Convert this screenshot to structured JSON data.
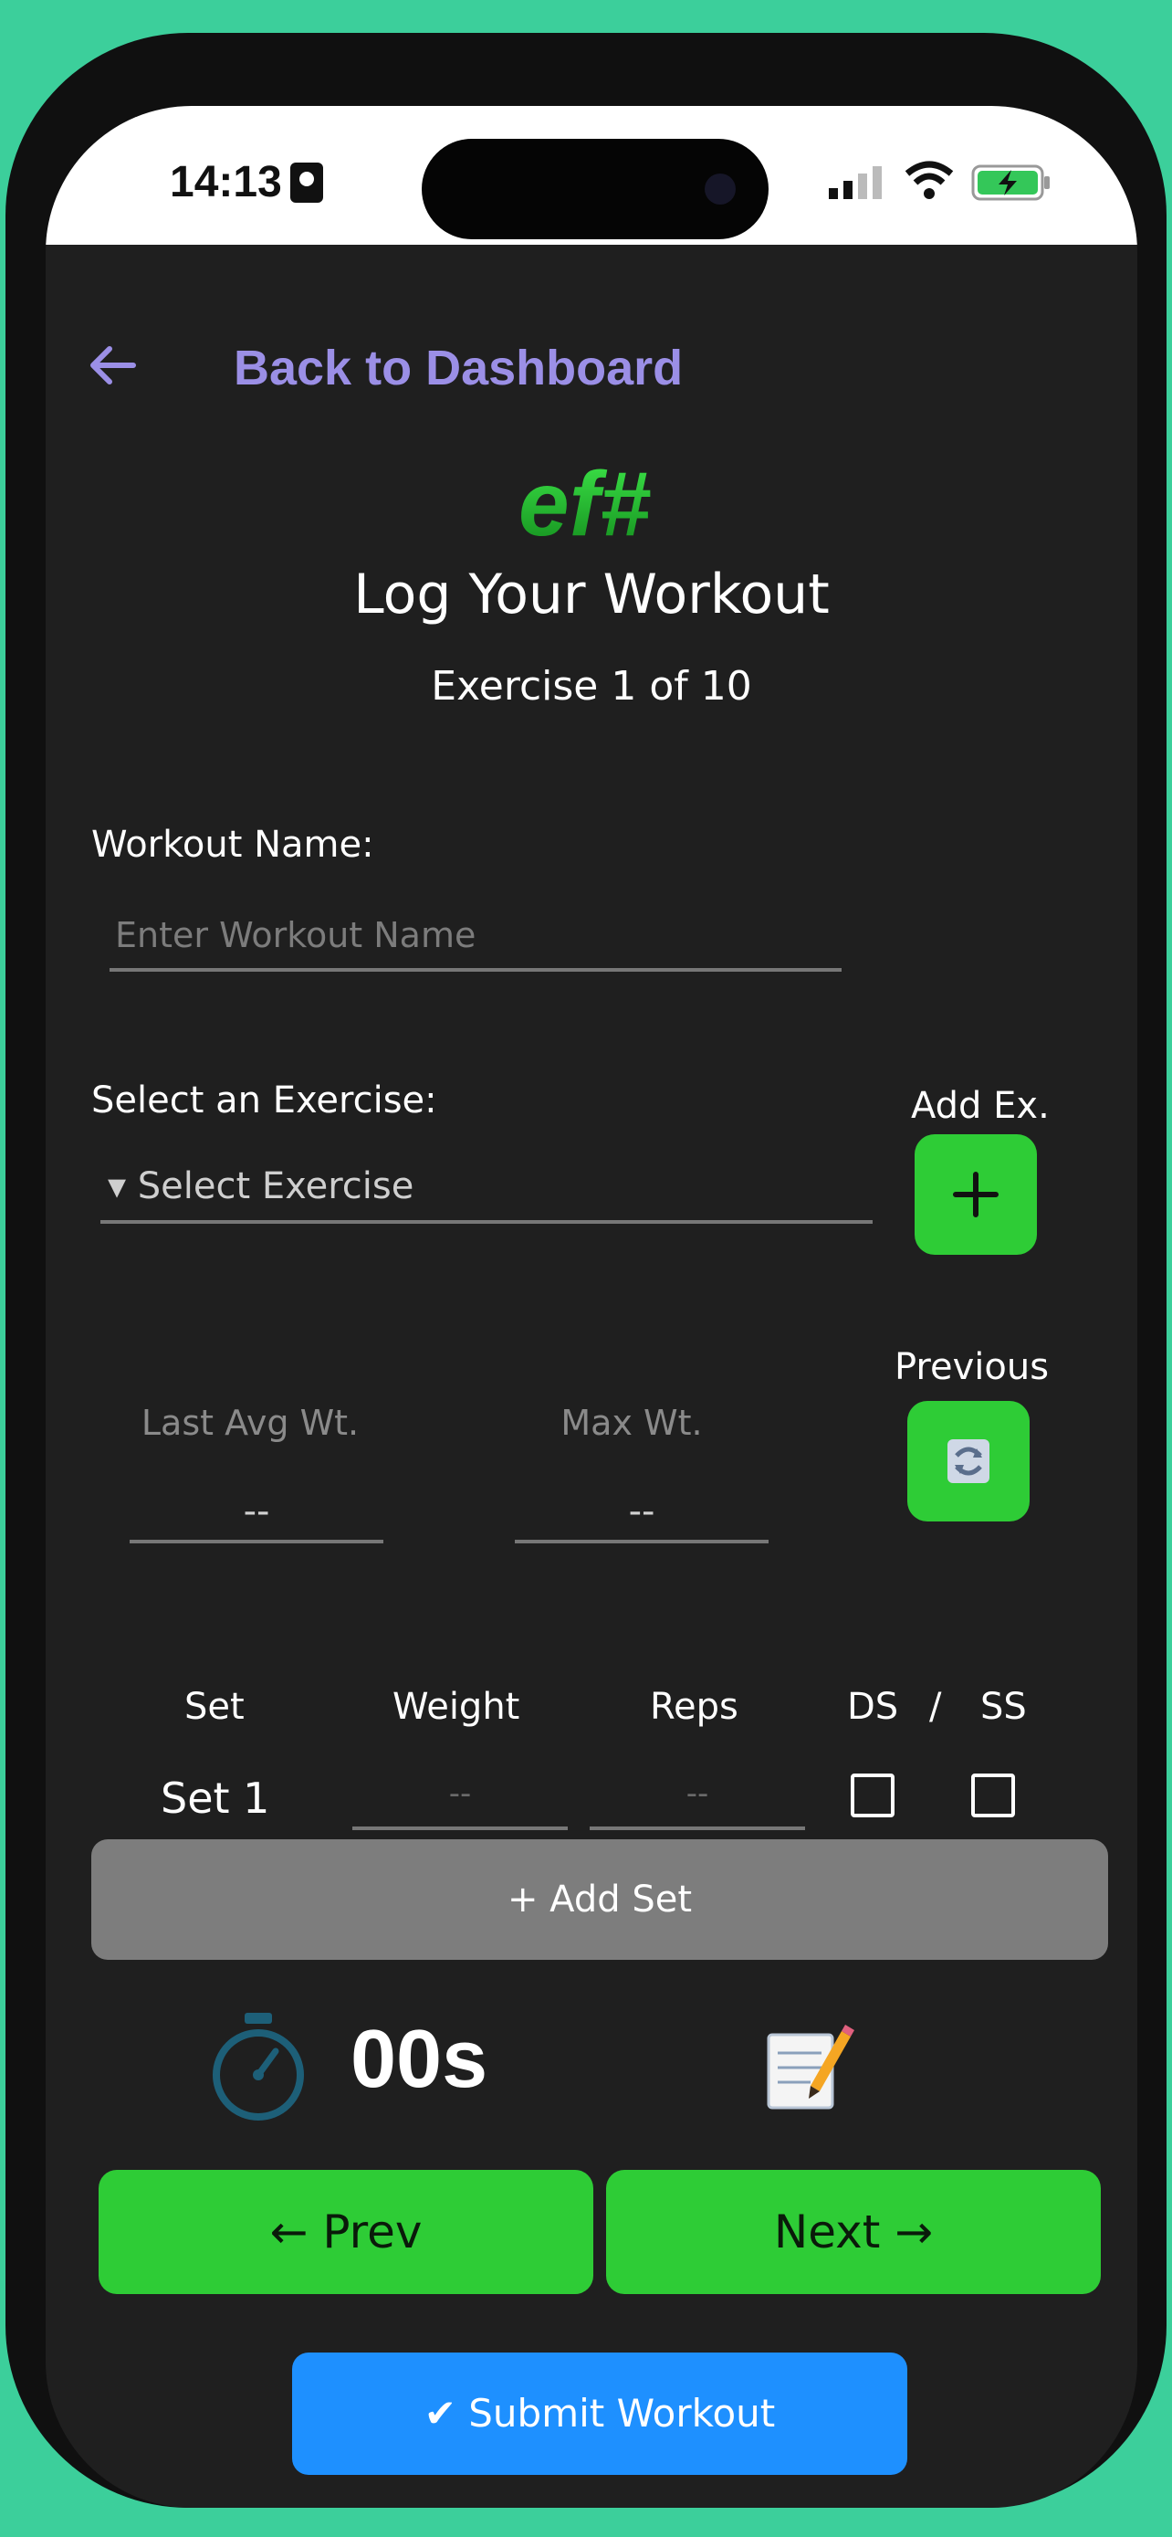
{
  "status_bar": {
    "time": "14:13"
  },
  "header": {
    "back_label": "Back to Dashboard"
  },
  "logo": {
    "text": "ef#"
  },
  "page": {
    "title": "Log Your Workout",
    "subtitle": "Exercise 1 of 10"
  },
  "workout_name": {
    "label": "Workout Name:",
    "placeholder": "Enter Workout Name",
    "value": ""
  },
  "exercise": {
    "label": "Select an Exercise:",
    "select_text": "▾ Select Exercise",
    "add_label": "Add Ex.",
    "add_icon": "plus-icon"
  },
  "stats": {
    "last_avg_label": "Last Avg Wt.",
    "last_avg_value": "--",
    "max_label": "Max Wt.",
    "max_value": "--",
    "previous_label": "Previous",
    "previous_icon": "refresh-icon"
  },
  "sets": {
    "headers": {
      "set": "Set",
      "weight": "Weight",
      "reps": "Reps",
      "ds": "DS",
      "slash": "/",
      "ss": "SS"
    },
    "rows": [
      {
        "label": "Set 1",
        "weight": "--",
        "reps": "--",
        "ds": false,
        "ss": false
      }
    ],
    "add_label": "+ Add Set"
  },
  "timer": {
    "icon": "stopwatch-icon",
    "value": "00s",
    "notes_icon": "notes-icon"
  },
  "nav": {
    "prev_label": "← Prev",
    "next_label": "Next →"
  },
  "submit": {
    "label": "✔ Submit Workout"
  },
  "colors": {
    "background": "#3ccf9b",
    "screen": "#1f1f1f",
    "accent_purple": "#9b8fe6",
    "green": "#2ecc36",
    "blue": "#1e90ff",
    "gray_button": "#7d7d7d"
  }
}
